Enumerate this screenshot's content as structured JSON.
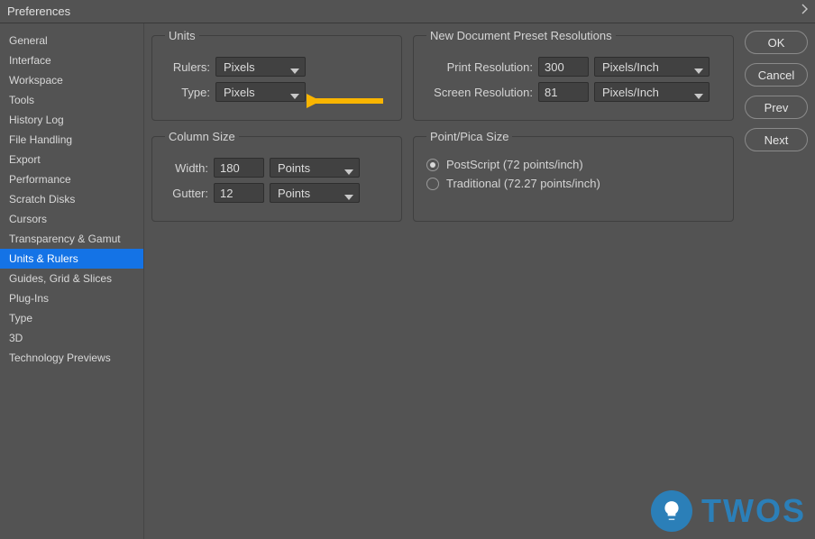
{
  "title": "Preferences",
  "sidebar": {
    "items": [
      "General",
      "Interface",
      "Workspace",
      "Tools",
      "History Log",
      "File Handling",
      "Export",
      "Performance",
      "Scratch Disks",
      "Cursors",
      "Transparency & Gamut",
      "Units & Rulers",
      "Guides, Grid & Slices",
      "Plug-Ins",
      "Type",
      "3D",
      "Technology Previews"
    ],
    "selected_index": 11
  },
  "units": {
    "legend": "Units",
    "rulers_label": "Rulers:",
    "rulers_value": "Pixels",
    "type_label": "Type:",
    "type_value": "Pixels"
  },
  "column_size": {
    "legend": "Column Size",
    "width_label": "Width:",
    "width_value": "180",
    "width_unit": "Points",
    "gutter_label": "Gutter:",
    "gutter_value": "12",
    "gutter_unit": "Points"
  },
  "new_doc": {
    "legend": "New Document Preset Resolutions",
    "print_label": "Print Resolution:",
    "print_value": "300",
    "print_unit": "Pixels/Inch",
    "screen_label": "Screen Resolution:",
    "screen_value": "81",
    "screen_unit": "Pixels/Inch"
  },
  "point_pica": {
    "legend": "Point/Pica Size",
    "postscript_label": "PostScript (72 points/inch)",
    "traditional_label": "Traditional (72.27 points/inch)",
    "selected": "postscript"
  },
  "buttons": {
    "ok": "OK",
    "cancel": "Cancel",
    "prev": "Prev",
    "next": "Next"
  },
  "annotation": {
    "arrow_color": "#f9b500"
  },
  "watermark": {
    "text": "TWOS",
    "icon": "bulb-icon"
  }
}
